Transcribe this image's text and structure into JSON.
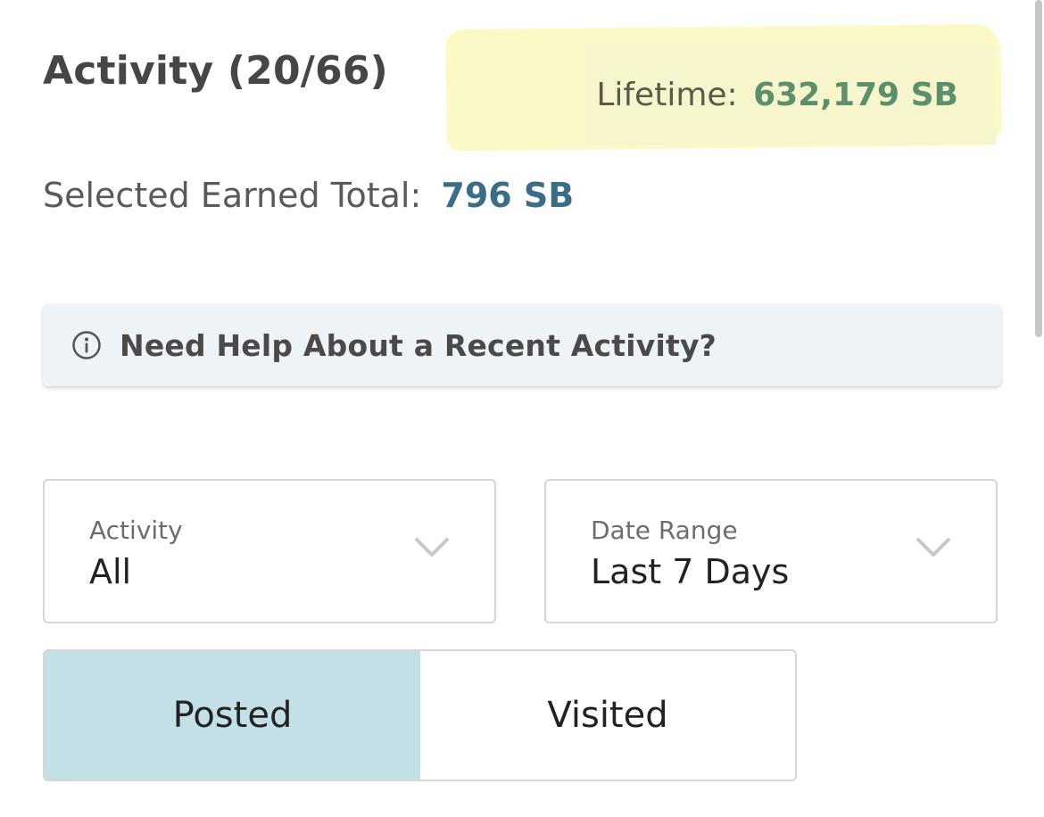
{
  "header": {
    "title": "Activity (20/66)",
    "lifetime_label": "Lifetime:",
    "lifetime_value": "632,179 SB",
    "selected_label": "Selected Earned Total:",
    "selected_value": "796 SB"
  },
  "help_banner": {
    "icon": "info-circle-icon",
    "text": "Need Help About a Recent Activity?"
  },
  "filters": {
    "activity": {
      "label": "Activity",
      "value": "All",
      "icon": "chevron-down-icon"
    },
    "date_range": {
      "label": "Date Range",
      "value": "Last 7 Days",
      "icon": "chevron-down-icon"
    }
  },
  "segmented": {
    "posted_label": "Posted",
    "visited_label": "Visited",
    "selected": "Posted"
  },
  "colors": {
    "highlight": "#fbf9c2",
    "lifetime_value": "#5c8f6c",
    "selected_value": "#3a6e86",
    "banner_bg": "#edf3f7",
    "segment_active": "#c3e0e7"
  }
}
